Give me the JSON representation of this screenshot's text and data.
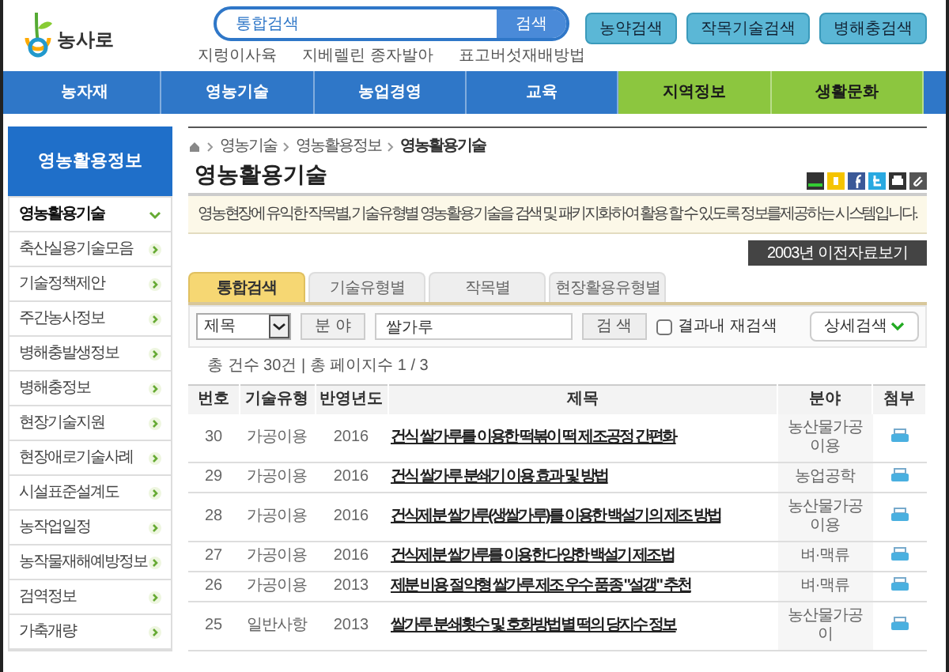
{
  "logo": {
    "text": "농사로"
  },
  "search": {
    "placeholder": "통합검색",
    "button": "검색",
    "keywords": [
      "지렁이사육",
      "지베렐린 종자발아",
      "표고버섯재배방법"
    ]
  },
  "top_buttons": [
    "농약검색",
    "작목기술검색",
    "병해충검색"
  ],
  "nav": [
    {
      "label": "농자재",
      "color": "#2f77c8"
    },
    {
      "label": "영농기술",
      "color": "#2f77c8"
    },
    {
      "label": "농업경영",
      "color": "#2f77c8"
    },
    {
      "label": "교육",
      "color": "#2f77c8"
    },
    {
      "label": "지역정보",
      "color": "#8cc63f"
    },
    {
      "label": "생활문화",
      "color": "#8cc63f"
    }
  ],
  "sidebar": {
    "title": "영농활용정보",
    "items": [
      {
        "label": "영농활용기술",
        "selected": true
      },
      {
        "label": "축산실용기술모음",
        "selected": false
      },
      {
        "label": "기술정책제안",
        "selected": false
      },
      {
        "label": "주간농사정보",
        "selected": false
      },
      {
        "label": "병해충발생정보",
        "selected": false
      },
      {
        "label": "병해충정보",
        "selected": false
      },
      {
        "label": "현장기술지원",
        "selected": false
      },
      {
        "label": "현장애로기술사례",
        "selected": false
      },
      {
        "label": "시설표준설계도",
        "selected": false
      },
      {
        "label": "농작업일정",
        "selected": false
      },
      {
        "label": "농작물재해예방정보",
        "selected": false
      },
      {
        "label": "검역정보",
        "selected": false
      },
      {
        "label": "가축개량",
        "selected": false
      }
    ]
  },
  "breadcrumb": [
    "영농기술",
    "영농활용정보",
    "영농활용기술"
  ],
  "page_title": "영농활용기술",
  "description": "영농현장에 유익한 작목별, 기술유형별 영농활용기술을 검색 및 패키지화하여 활용 할 수 있도록 정보를제공하는 시스템입니다.",
  "archive_button": "2003년 이전자료보기",
  "tabs": [
    {
      "label": "통합검색",
      "selected": true
    },
    {
      "label": "기술유형별",
      "selected": false
    },
    {
      "label": "작목별",
      "selected": false
    },
    {
      "label": "현장활용유형별",
      "selected": false
    }
  ],
  "filter": {
    "select": "제목",
    "field_button": "분 야",
    "query": "쌀가루",
    "search_button": "검 색",
    "refine": {
      "label": "결과내 재검색",
      "checked": false
    },
    "detail_button": "상세검색"
  },
  "summary": "총 건수 30건 | 총 페이지수 1 / 3",
  "table": {
    "columns": [
      "번호",
      "기술유형",
      "반영년도",
      "제목",
      "분야",
      "첨부"
    ],
    "rows": [
      [
        "30",
        "가공이용",
        "2016",
        "건식 쌀가루를 이용한 떡볶이 떡 제조공정 간편화",
        "농산물가공이용"
      ],
      [
        "29",
        "가공이용",
        "2016",
        "건식 쌀가루 분쇄기 이용 효과 및 방법",
        "농업공학"
      ],
      [
        "28",
        "가공이용",
        "2016",
        "건식제분 쌀가루(생쌀가루)를 이용한 백설기의 제조 방법",
        "농산물가공이용"
      ],
      [
        "27",
        "가공이용",
        "2016",
        "건식제분 쌀가루를 이용한 다양한 백설기 제조법",
        "벼·맥류"
      ],
      [
        "26",
        "가공이용",
        "2013",
        "제분 비용 절약형 쌀가루 제조 우수 품종 \"설갱\" 추천",
        "벼·맥류"
      ],
      [
        "25",
        "일반사항",
        "2013",
        "쌀가루 분쇄횟수 및 호화방법별 떡의 당지수 정보",
        "농산물가공이"
      ]
    ]
  }
}
